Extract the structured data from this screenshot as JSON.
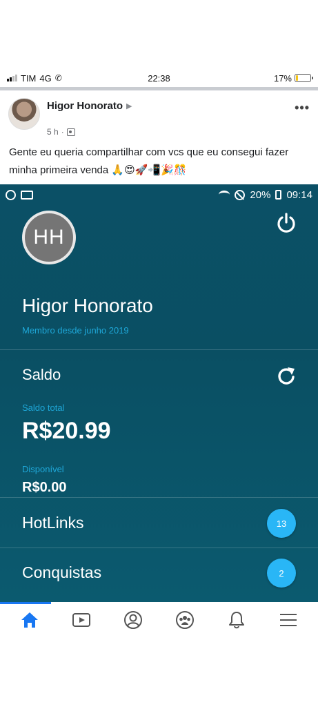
{
  "status_bar": {
    "carrier": "TIM",
    "network": "4G",
    "time": "22:38",
    "battery": "17%",
    "battery_level": 0.17
  },
  "post": {
    "author": "Higor Honorato",
    "time": "5 h",
    "separator": "·",
    "text": "Gente eu queria compartilhar com vcs que eu consegui fazer minha primeira venda 🙏😍🚀📲🎉🎊",
    "more_label": "•••"
  },
  "screenshot": {
    "status": {
      "battery": "20%",
      "time": "09:14"
    },
    "profile": {
      "initials": "HH",
      "name": "Higor Honorato",
      "member_since": "Membro desde junho 2019"
    },
    "balance": {
      "title": "Saldo",
      "total_label": "Saldo total",
      "total_value": "R$20.99",
      "available_label": "Disponível",
      "available_value": "R$0.00"
    },
    "menu": [
      {
        "label": "HotLinks",
        "count": "13"
      },
      {
        "label": "Conquistas",
        "count": "2"
      }
    ]
  },
  "bottom_nav": {
    "items": [
      "home",
      "watch",
      "profile",
      "groups",
      "notifications",
      "menu"
    ],
    "active": "home",
    "accent": "#1877f2"
  },
  "colors": {
    "app_background": "#0b5066",
    "app_accent": "#1ea7d8",
    "badge": "#29b6f6"
  }
}
